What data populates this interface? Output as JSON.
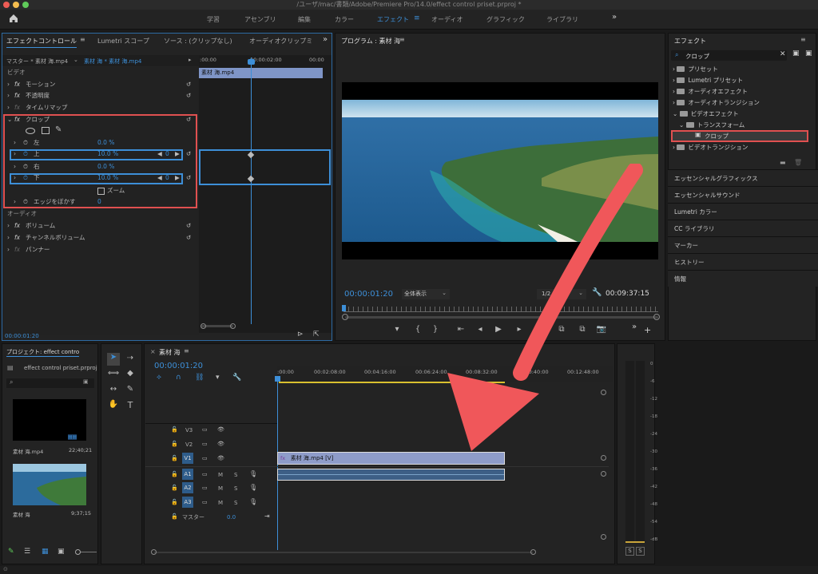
{
  "window": {
    "title": "/ユーザ/mac/書類/Adobe/Premiere Pro/14.0/effect control priset.prproj *"
  },
  "workspaces": [
    "学習",
    "アセンブリ",
    "編集",
    "カラー",
    "エフェクト",
    "オーディオ",
    "グラフィック",
    "ライブラリ"
  ],
  "workspace_active": "エフェクト",
  "effect_controls": {
    "tabs": [
      "エフェクトコントロール",
      "Lumetri スコープ",
      "ソース : (クリップなし)",
      "オーディオクリップミ"
    ],
    "master": "マスター * 素材 海.mp4",
    "clip": "素材 海 * 素材 海.mp4",
    "video_header": "ビデオ",
    "audio_header": "オーディオ",
    "fx_label": "fx",
    "motion": "モーション",
    "opacity": "不透明度",
    "time_remap": "タイムリマップ",
    "crop": "クロップ",
    "left_label": "左",
    "left_val": "0.0 %",
    "top_label": "上",
    "top_val": "10.0 %",
    "top_kf": "0",
    "right_label": "右",
    "right_val": "0.0 %",
    "bottom_label": "下",
    "bottom_val": "10.0 %",
    "bottom_kf": "0",
    "zoom_label": "ズーム",
    "feather_label": "エッジをぼかす",
    "feather_val": "0",
    "volume": "ボリューム",
    "channel_volume": "チャンネルボリューム",
    "panner": "パンナー",
    "timecode": "00:00:01:20",
    "ruler_start": ":00:00",
    "ruler_mid": "00:00:02:00",
    "ruler_end": "00:00",
    "clip_bar": "素材 海.mp4"
  },
  "program": {
    "title": "プログラム : 素材 海",
    "timecode": "00:00:01:20",
    "fit": "全体表示",
    "resolution": "1/2",
    "duration": "00:09:37:15"
  },
  "effects_panel": {
    "title": "エフェクト",
    "search": "クロップ",
    "items": [
      "プリセット",
      "Lumetri プリセット",
      "オーディオエフェクト",
      "オーディオトランジション",
      "ビデオエフェクト",
      "トランスフォーム",
      "クロップ",
      "ビデオトランジション"
    ],
    "sections": [
      "エッセンシャルグラフィックス",
      "エッセンシャルサウンド",
      "Lumetri カラー",
      "CC ライブラリ",
      "マーカー",
      "ヒストリー",
      "情報"
    ]
  },
  "project": {
    "tab": "プロジェクト: effect contro",
    "file": "effect control priset.prproj",
    "item1_name": "素材 海.mp4",
    "item1_dur": "22;40;21",
    "item2_name": "素材 海",
    "item2_dur": "9;37;15"
  },
  "timeline": {
    "tab": "素材 海",
    "timecode": "00:00:01:20",
    "ruler": [
      ":00:00",
      "00:02:08:00",
      "00:04:16:00",
      "00:06:24:00",
      "00:08:32:00",
      "00:10:40:00",
      "00:12:48:00"
    ],
    "video_tracks": [
      "V3",
      "V2",
      "V1"
    ],
    "audio_tracks": [
      "A1",
      "A2",
      "A3"
    ],
    "master_label": "マスター",
    "master_val": "0.0",
    "m": "M",
    "s": "S",
    "clip_label": "素材 海.mp4 [V]"
  },
  "meter": {
    "scale": [
      "0",
      "-6",
      "-12",
      "-18",
      "-24",
      "-30",
      "-36",
      "-42",
      "-48",
      "-54",
      "-dB"
    ],
    "solo": [
      "S",
      "S"
    ]
  },
  "colors": {
    "accent": "#3d8fd8",
    "highlight": "#e05050",
    "arrow": "#f0575a"
  }
}
